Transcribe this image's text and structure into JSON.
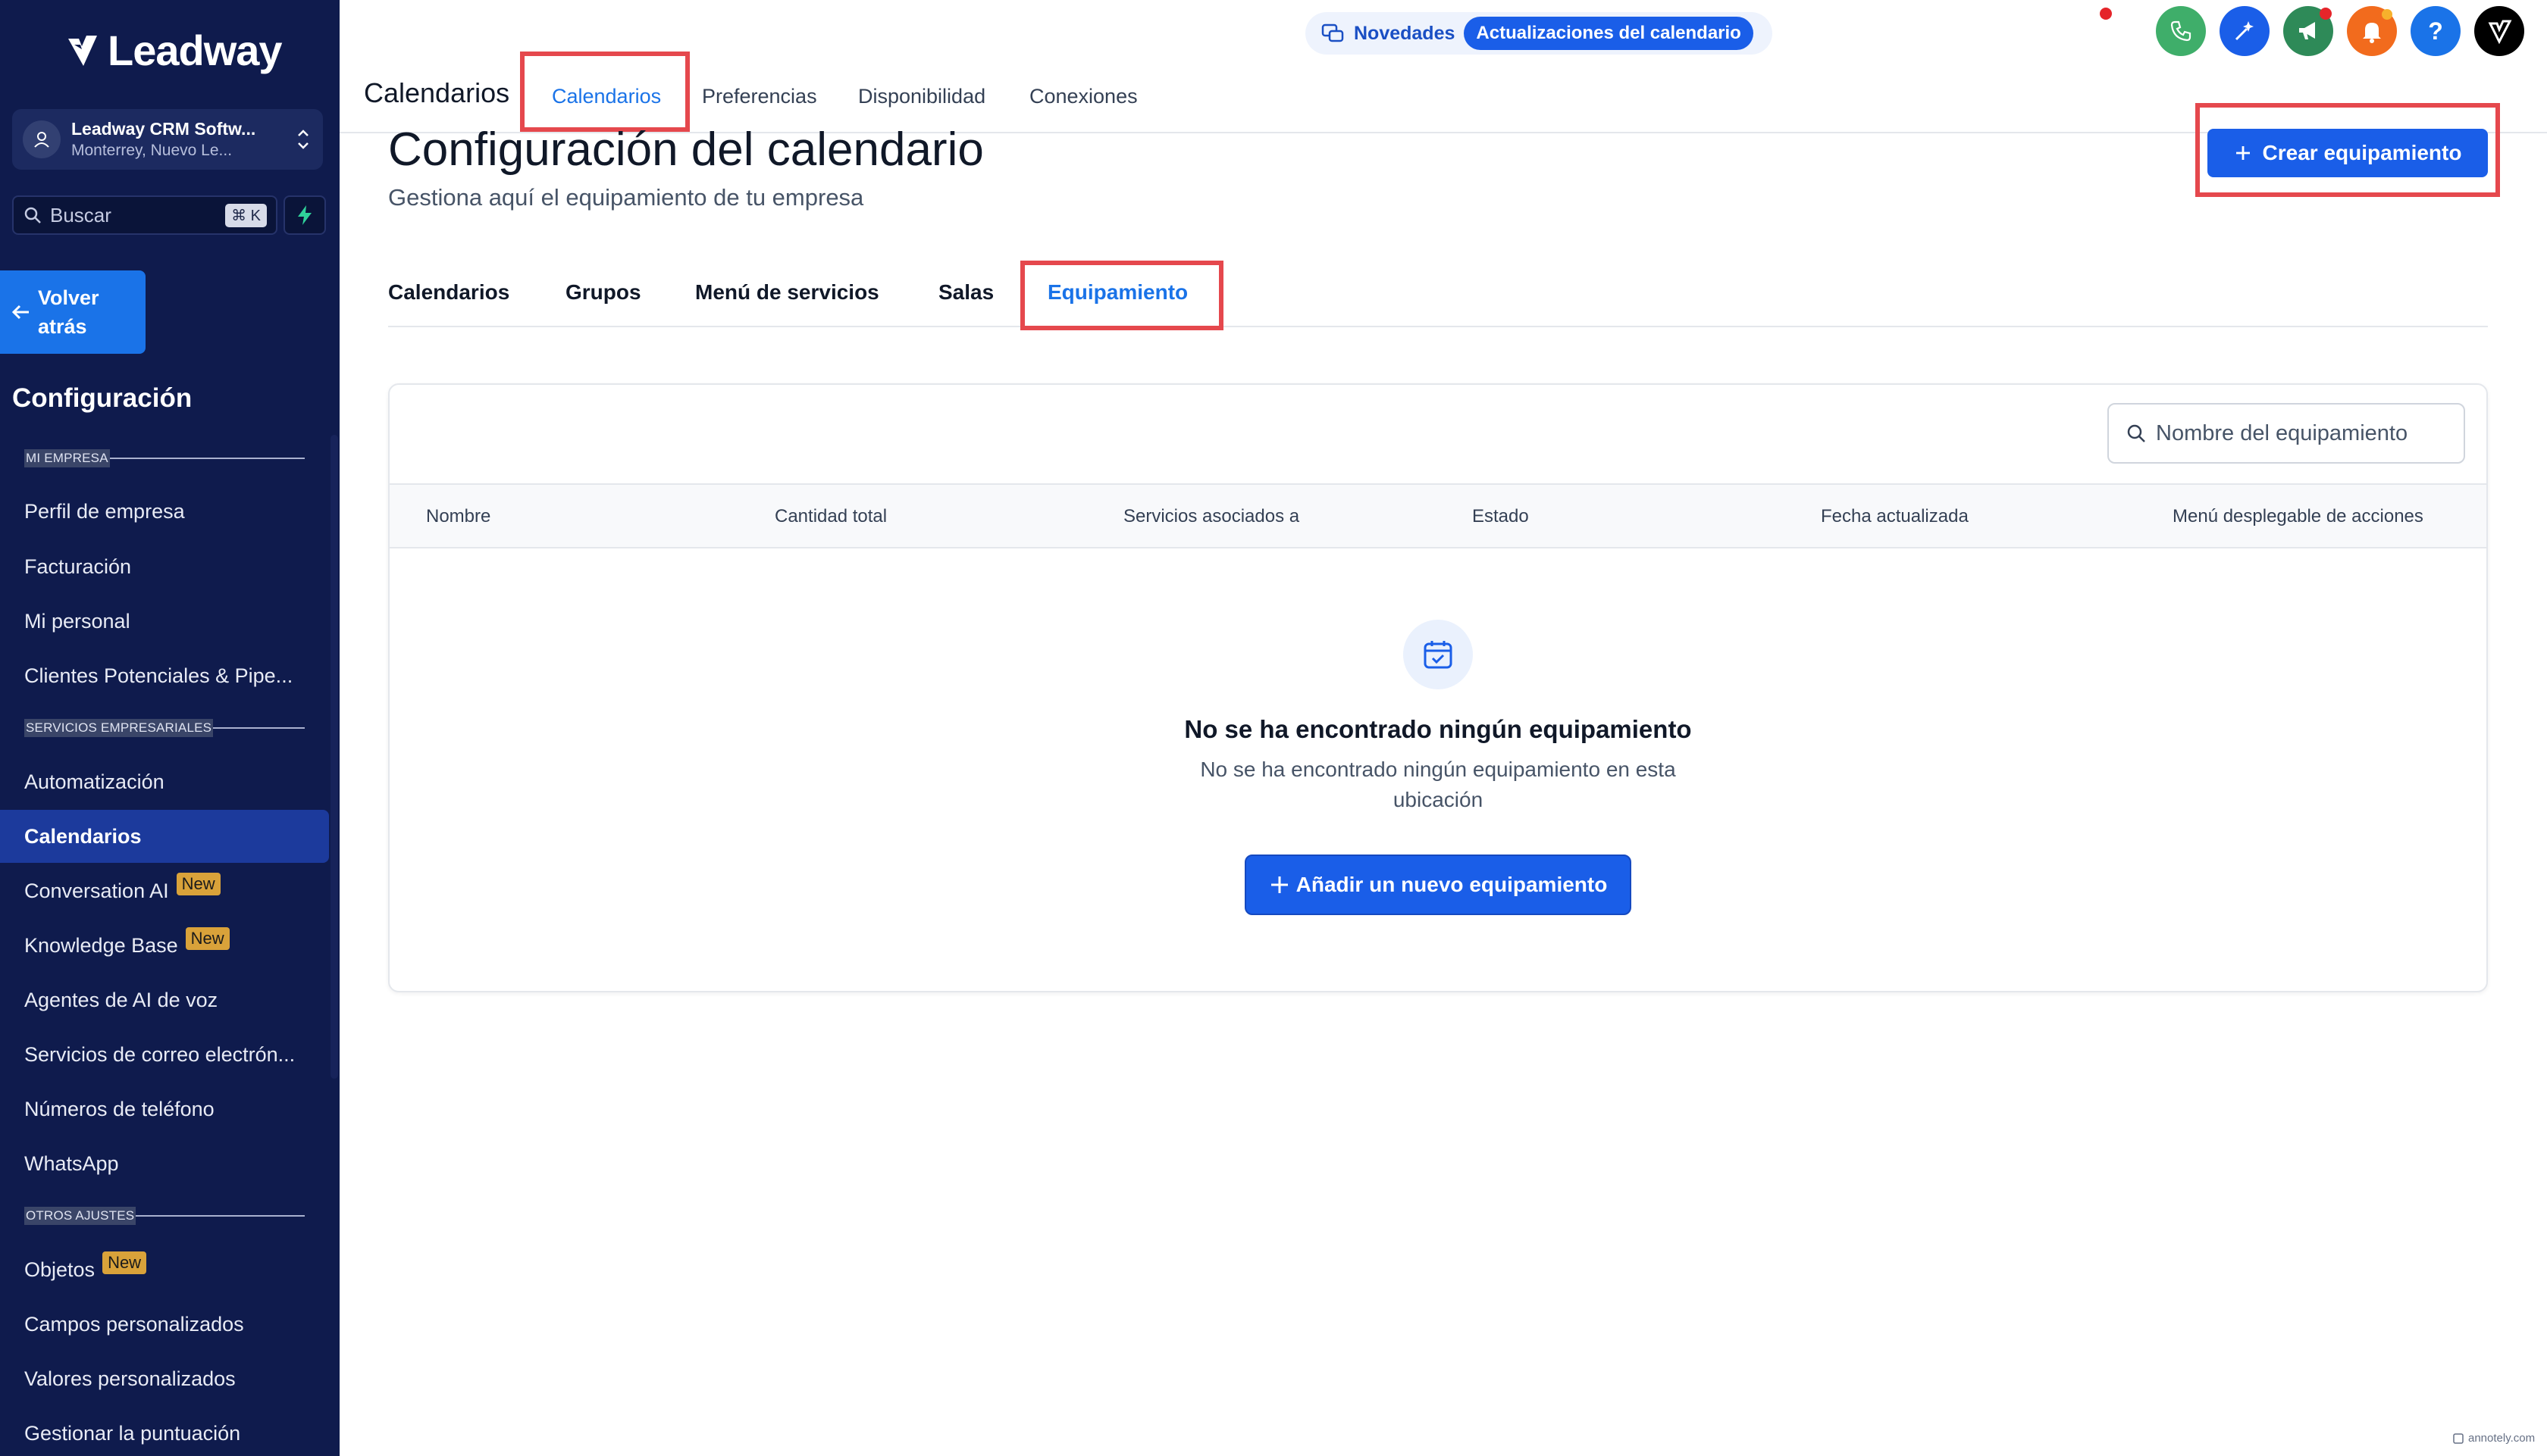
{
  "sidebar": {
    "logo_text": "Leadway",
    "account_name": "Leadway CRM Softw...",
    "account_location": "Monterrey, Nuevo Le...",
    "search_label": "Buscar",
    "search_shortcut": "⌘ K",
    "back_label_line1": "Volver",
    "back_label_line2": "atrás",
    "config_title": "Configuración",
    "sections": {
      "mi_empresa": "MI EMPRESA",
      "servicios": "SERVICIOS EMPRESARIALES",
      "otros": "OTROS AJUSTES"
    },
    "items": [
      {
        "label": "Perfil de empresa"
      },
      {
        "label": "Facturación"
      },
      {
        "label": "Mi personal"
      },
      {
        "label": "Clientes Potenciales & Pipe..."
      },
      {
        "label": "Automatización"
      },
      {
        "label": "Calendarios",
        "active": true
      },
      {
        "label": "Conversation AI",
        "badge": "New"
      },
      {
        "label": "Knowledge Base",
        "badge": "New"
      },
      {
        "label": "Agentes de AI de voz"
      },
      {
        "label": "Servicios de correo electrón..."
      },
      {
        "label": "Números de teléfono"
      },
      {
        "label": "WhatsApp"
      },
      {
        "label": "Objetos",
        "badge": "New"
      },
      {
        "label": "Campos personalizados"
      },
      {
        "label": "Valores personalizados"
      },
      {
        "label": "Gestionar la puntuación"
      }
    ]
  },
  "topbar": {
    "title": "Calendarios",
    "tabs": [
      {
        "label": "Calendarios",
        "active": true
      },
      {
        "label": "Preferencias"
      },
      {
        "label": "Disponibilidad"
      },
      {
        "label": "Conexiones"
      }
    ],
    "novedades_label": "Novedades",
    "updates_label": "Actualizaciones del calendario",
    "icons": [
      "phone-icon",
      "magic-icon",
      "megaphone-icon",
      "bell-icon",
      "help-icon",
      "user-logo-icon"
    ],
    "help_glyph": "?"
  },
  "main": {
    "title": "Configuración del calendario",
    "subtitle": "Gestiona aquí el equipamiento de tu empresa",
    "create_button": "Crear equipamiento",
    "sub_tabs": [
      {
        "label": "Calendarios"
      },
      {
        "label": "Grupos"
      },
      {
        "label": "Menú de servicios"
      },
      {
        "label": "Salas"
      },
      {
        "label": "Equipamiento",
        "active": true
      }
    ],
    "search_placeholder": "Nombre del equipamiento",
    "columns": [
      "Nombre",
      "Cantidad total",
      "Servicios asociados a",
      "Estado",
      "Fecha actualizada",
      "Menú desplegable de acciones"
    ],
    "empty_title": "No se ha encontrado ningún equipamiento",
    "empty_description": "No se ha encontrado ningún equipamiento en esta ubicación",
    "add_button": "Añadir un nuevo equipamiento"
  },
  "watermark": "annotely.com",
  "colors": {
    "sidebar_bg": "#0f1b4d",
    "primary": "#1a5ee8",
    "highlight_box": "#e5484d",
    "badge": "#d9a23a"
  }
}
